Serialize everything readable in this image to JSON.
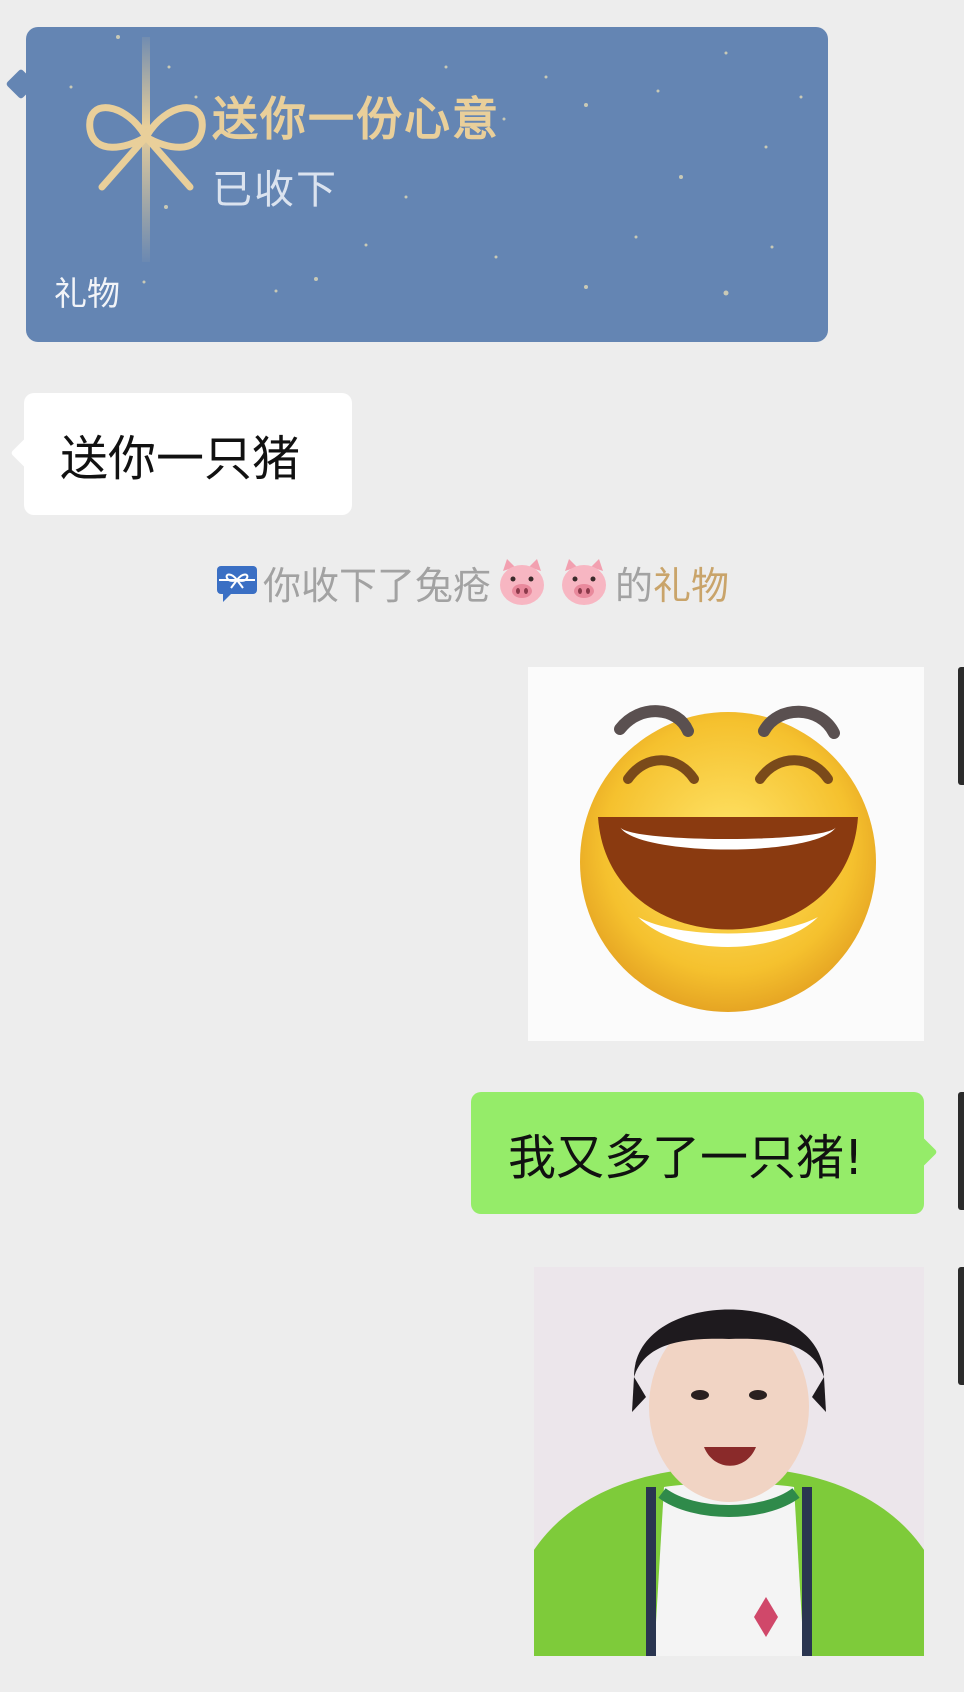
{
  "gift_card": {
    "title": "送你一份心意",
    "status": "已收下",
    "footer": "礼物",
    "color_bg": "#6485b3",
    "color_title": "#e9cf9a",
    "icon": "ribbon-bow-icon"
  },
  "messages": {
    "incoming_text": "送你一只猪",
    "outgoing_text": "我又多了一只猪!"
  },
  "notice": {
    "prefix": "你收下了兔疮",
    "emojis": [
      "pig-face-emoji",
      "pig-face-emoji"
    ],
    "middle": "的",
    "link": "礼物",
    "icon": "gift-notice-icon"
  },
  "stickers": {
    "laugh": "laughing-face-sticker",
    "boy": "smiling-boy-sticker"
  },
  "colors": {
    "background": "#ededed",
    "outgoing_bubble": "#95ec69",
    "incoming_bubble": "#ffffff",
    "notice_link": "#c9a46a"
  }
}
